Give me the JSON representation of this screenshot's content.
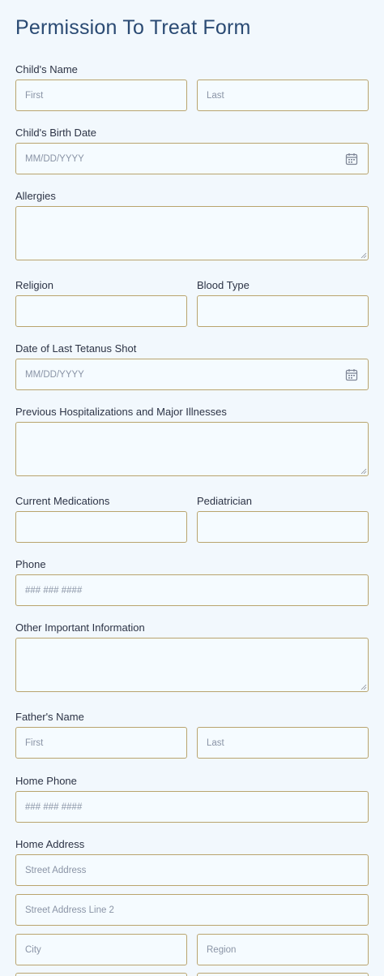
{
  "form": {
    "title": "Permission To Treat Form",
    "childs_name": {
      "label": "Child's Name",
      "first": "First",
      "last": "Last"
    },
    "childs_birth_date": {
      "label": "Child's Birth Date",
      "placeholder": "MM/DD/YYYY"
    },
    "allergies": {
      "label": "Allergies"
    },
    "religion": {
      "label": "Religion"
    },
    "blood_type": {
      "label": "Blood Type"
    },
    "tetanus": {
      "label": "Date of Last Tetanus Shot",
      "placeholder": "MM/DD/YYYY"
    },
    "hospitalizations": {
      "label": "Previous Hospitalizations and Major Illnesses"
    },
    "medications": {
      "label": "Current Medications"
    },
    "pediatrician": {
      "label": "Pediatrician"
    },
    "phone": {
      "label": "Phone",
      "placeholder": "### ### ####"
    },
    "other_info": {
      "label": "Other Important Information"
    },
    "fathers_name": {
      "label": "Father's Name",
      "first": "First",
      "last": "Last"
    },
    "home_phone": {
      "label": "Home Phone",
      "placeholder": "### ### ####"
    },
    "home_address": {
      "label": "Home Address",
      "street": "Street Address",
      "street2": "Street Address Line 2",
      "city": "City",
      "region": "Region"
    }
  },
  "icons": {
    "calendar": "calendar-icon",
    "resize": "resize-handle-icon"
  },
  "colors": {
    "background": "#eaf4fb",
    "title": "#2a4a73",
    "field_border": "#b9a46e",
    "placeholder": "#8a94a6"
  }
}
